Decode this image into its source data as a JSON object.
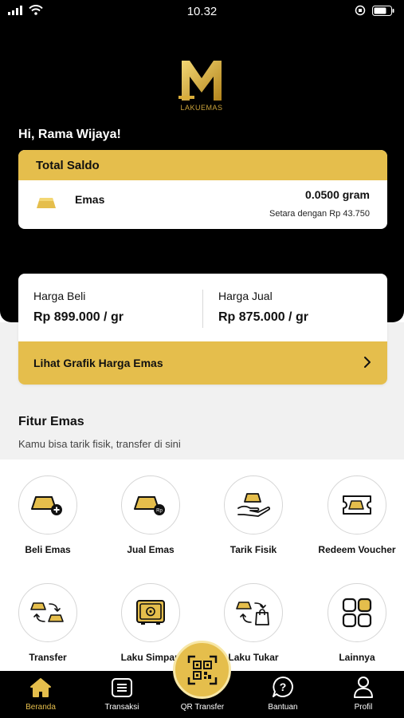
{
  "status_bar": {
    "time": "10.32"
  },
  "logo": {
    "text": "LAKUEMAS"
  },
  "greeting": "Hi, Rama Wijaya!",
  "saldo": {
    "title": "Total Saldo",
    "asset_label": "Emas",
    "amount": "0.0500 gram",
    "equivalent": "Setara dengan Rp 43.750"
  },
  "prices": {
    "buy_label": "Harga Beli",
    "buy_value": "Rp 899.000 / gr",
    "sell_label": "Harga Jual",
    "sell_value": "Rp 875.000 / gr",
    "chart_link": "Lihat Grafik Harga Emas"
  },
  "fitur": {
    "title": "Fitur Emas",
    "subtitle": "Kamu bisa tarik fisik, transfer di sini",
    "items": [
      {
        "label": "Beli Emas",
        "icon": "gold-bar-plus-icon"
      },
      {
        "label": "Jual Emas",
        "icon": "gold-bar-rp-icon"
      },
      {
        "label": "Tarik Fisik",
        "icon": "hand-gold-icon"
      },
      {
        "label": "Redeem Voucher",
        "icon": "voucher-icon"
      },
      {
        "label": "Transfer",
        "icon": "transfer-gold-icon"
      },
      {
        "label": "Laku Simpan",
        "icon": "safe-icon"
      },
      {
        "label": "Laku Tukar",
        "icon": "exchange-bag-icon"
      },
      {
        "label": "Lainnya",
        "icon": "grid-icon"
      }
    ]
  },
  "tabbar": {
    "items": [
      {
        "label": "Beranda",
        "icon": "home-icon",
        "active": true
      },
      {
        "label": "Transaksi",
        "icon": "receipt-icon",
        "active": false
      },
      {
        "label": "QR Transfer",
        "icon": "qr-icon",
        "active": false
      },
      {
        "label": "Bantuan",
        "icon": "help-icon",
        "active": false
      },
      {
        "label": "Profil",
        "icon": "profile-icon",
        "active": false
      }
    ]
  },
  "colors": {
    "gold": "#e5be4c",
    "black": "#000000",
    "gold_dark": "#b88a1f"
  }
}
